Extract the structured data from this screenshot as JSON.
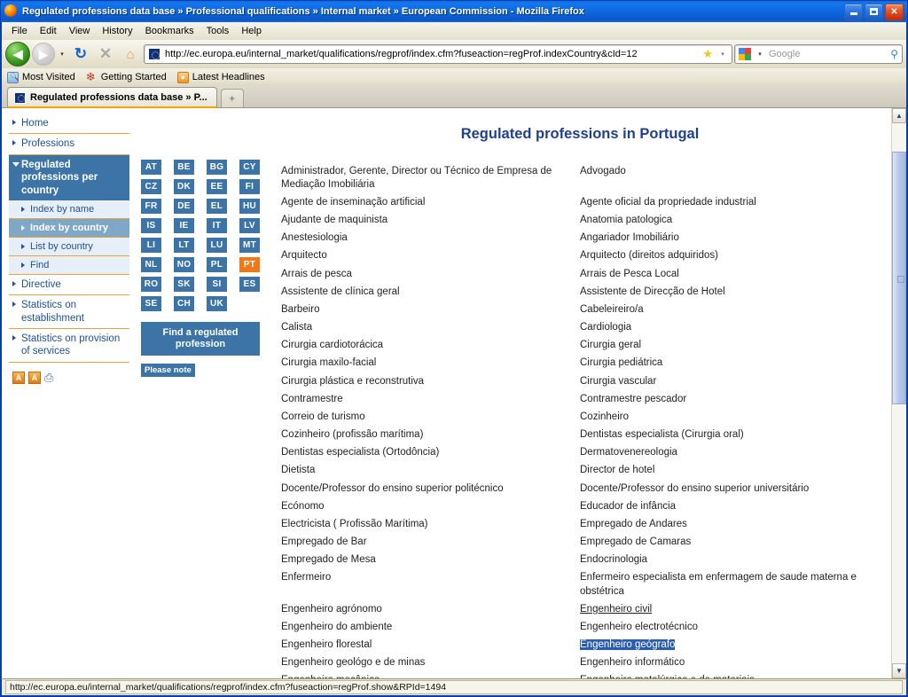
{
  "window": {
    "title": "Regulated professions data base » Professional qualifications » Internal market » European Commission - Mozilla Firefox",
    "minimize_label": "_",
    "maximize_label": "□",
    "close_label": "✕"
  },
  "menubar": [
    {
      "label": "File"
    },
    {
      "label": "Edit"
    },
    {
      "label": "View"
    },
    {
      "label": "History"
    },
    {
      "label": "Bookmarks"
    },
    {
      "label": "Tools"
    },
    {
      "label": "Help"
    }
  ],
  "toolbar": {
    "back_glyph": "◀",
    "forward_glyph": "▶",
    "dropdown_glyph": "▾",
    "reload_glyph": "↻",
    "stop_glyph": "✕",
    "home_glyph": "⌂",
    "url": "http://ec.europa.eu/internal_market/qualifications/regprof/index.cfm?fuseaction=regProf.indexCountry&cId=12",
    "bookmark_star": "★",
    "search_placeholder": "Google",
    "search_value": "",
    "search_glyph": "⚲"
  },
  "bookmarks": [
    {
      "label": "Most Visited",
      "icon": "most-visited-icon"
    },
    {
      "label": "Getting Started",
      "icon": "getting-started-icon"
    },
    {
      "label": "Latest Headlines",
      "icon": "rss-icon"
    }
  ],
  "tabs": {
    "active_tab_label": "Regulated professions data base » P...",
    "new_tab_glyph": "+"
  },
  "sidebar": {
    "items": [
      {
        "label": "Home",
        "type": "top",
        "state": "normal"
      },
      {
        "label": "Professions",
        "type": "top",
        "state": "normal"
      },
      {
        "label": "Regulated professions per country",
        "type": "top",
        "state": "active"
      },
      {
        "label": "Index by name",
        "type": "sub",
        "state": "normal"
      },
      {
        "label": "Index by country",
        "type": "sub",
        "state": "selected"
      },
      {
        "label": "List by country",
        "type": "sub",
        "state": "normal"
      },
      {
        "label": "Find",
        "type": "sub",
        "state": "normal"
      },
      {
        "label": "Directive",
        "type": "top",
        "state": "normal"
      },
      {
        "label": "Statistics on establishment",
        "type": "top",
        "state": "normal"
      },
      {
        "label": "Statistics on provision of services",
        "type": "top",
        "state": "normal"
      }
    ],
    "tools": [
      {
        "name": "decrease-text-size-icon",
        "label": "A"
      },
      {
        "name": "increase-text-size-icon",
        "label": "A"
      },
      {
        "name": "print-icon",
        "label": "⎙"
      }
    ]
  },
  "country_panel": {
    "codes": [
      "AT",
      "BE",
      "BG",
      "CY",
      "CZ",
      "DK",
      "EE",
      "FI",
      "FR",
      "DE",
      "EL",
      "HU",
      "IS",
      "IE",
      "IT",
      "LV",
      "LI",
      "LT",
      "LU",
      "MT",
      "NL",
      "NO",
      "PL",
      "PT",
      "RO",
      "SK",
      "SI",
      "ES",
      "SE",
      "CH",
      "UK"
    ],
    "selected_code": "PT",
    "find_button_label": "Find a regulated profession",
    "please_note_label": "Please note",
    "colors": {
      "box": "#3c74a8",
      "selected": "#f07818"
    }
  },
  "main": {
    "title": "Regulated professions in Portugal",
    "rows": [
      {
        "left": "Administrador, Gerente, Director ou Técnico de Empresa de Mediação Imobiliária",
        "right": "Advogado"
      },
      {
        "left": "Agente de inseminação artificial",
        "right": "Agente oficial da propriedade industrial"
      },
      {
        "left": "Ajudante de maquinista",
        "right": "Anatomia patologica"
      },
      {
        "left": "Anestesiologia",
        "right": "Angariador Imobiliário"
      },
      {
        "left": "Arquitecto",
        "right": "Arquitecto (direitos adquiridos)"
      },
      {
        "left": "Arrais de pesca",
        "right": "Arrais de Pesca Local"
      },
      {
        "left": "Assistente de clínica geral",
        "right": "Assistente de Direcção de Hotel"
      },
      {
        "left": "Barbeiro",
        "right": "Cabeleireiro/a"
      },
      {
        "left": "Calista",
        "right": "Cardiologia"
      },
      {
        "left": "Cirurgia cardiotorácica",
        "right": "Cirurgia geral"
      },
      {
        "left": "Cirurgia maxilo-facial",
        "right": "Cirurgia pediátrica"
      },
      {
        "left": "Cirurgia plástica e reconstrutiva",
        "right": "Cirurgia vascular"
      },
      {
        "left": "Contramestre",
        "right": "Contramestre pescador"
      },
      {
        "left": "Correio de turismo",
        "right": "Cozinheiro"
      },
      {
        "left": "Cozinheiro (profissão marítima)",
        "right": "Dentistas especialista (Cirurgia oral)"
      },
      {
        "left": "Dentistas especialista (Ortodôncia)",
        "right": "Dermatovenereologia"
      },
      {
        "left": "Dietista",
        "right": "Director de hotel"
      },
      {
        "left": "Docente/Professor do ensino superior politécnico",
        "right": "Docente/Professor do ensino superior universitário"
      },
      {
        "left": "Ecónomo",
        "right": "Educador de infância"
      },
      {
        "left": "Electricista ( Profissão Marítima)",
        "right": "Empregado de Andares"
      },
      {
        "left": "Empregado de Bar",
        "right": "Empregado de Camaras"
      },
      {
        "left": "Empregado de Mesa",
        "right": "Endocrinologia"
      },
      {
        "left": "Enfermeiro",
        "right": "Enfermeiro especialista em enfermagem de saude materna e obstétrica"
      },
      {
        "left": "Engenheiro agrónomo",
        "right": "Engenheiro civil",
        "right_state": "hover"
      },
      {
        "left": "Engenheiro do ambiente",
        "right": "Engenheiro electrotécnico"
      },
      {
        "left": "Engenheiro florestal",
        "right": "Engenheiro geógrafo",
        "right_state": "selected"
      },
      {
        "left": "Engenheiro geológo e de minas",
        "right": "Engenheiro informático"
      },
      {
        "left": "Engenheiro mecânico",
        "right": "Engenheiro metalúrgico e de materiais"
      }
    ]
  },
  "scrollbar": {
    "up_glyph": "▲",
    "down_glyph": "▼"
  },
  "statusbar": {
    "text": "http://ec.europa.eu/internal_market/qualifications/regprof/index.cfm?fuseaction=regProf.show&RPId=1494"
  }
}
